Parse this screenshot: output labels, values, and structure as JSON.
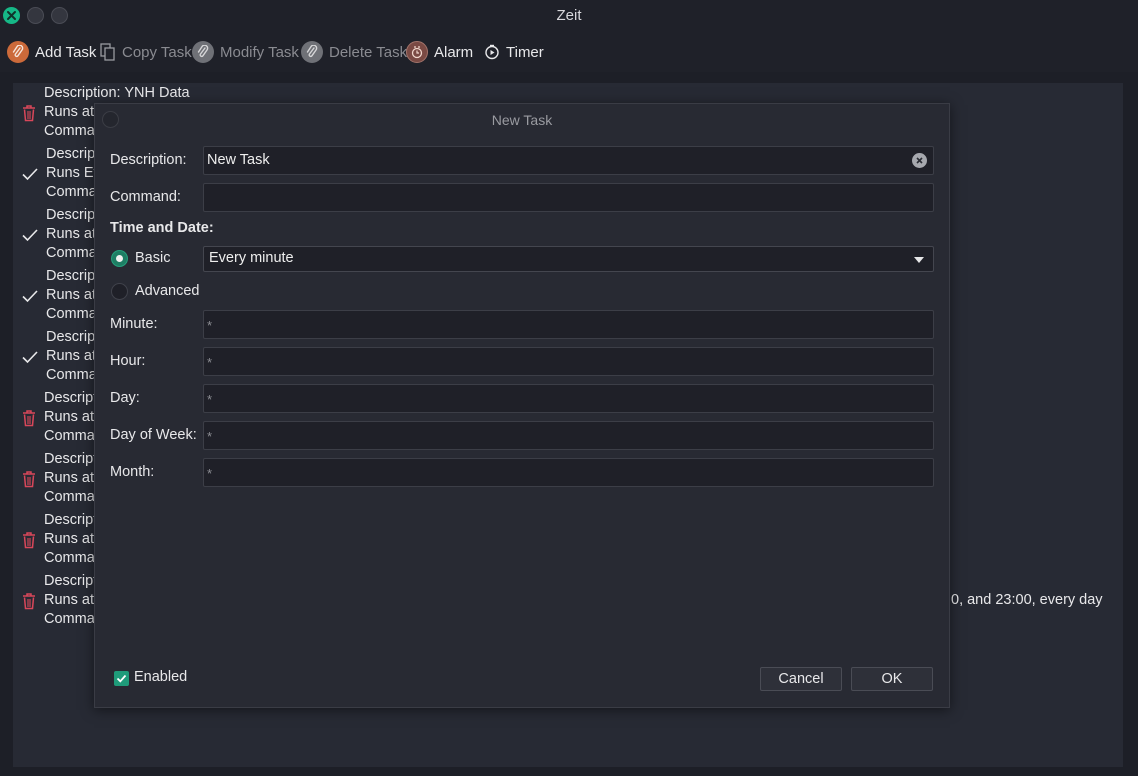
{
  "window": {
    "title": "Zeit"
  },
  "toolbar": {
    "add_task": "Add Task",
    "copy_task": "Copy Task",
    "modify_task": "Modify Task",
    "delete_task": "Delete Task",
    "alarm": "Alarm",
    "timer": "Timer"
  },
  "tasks": [
    {
      "status": "trash-icon",
      "l1": "Description: YNH Data",
      "l2": "Runs at (",
      "l3": "Comman"
    },
    {
      "status": "check-icon",
      "l1": "Descript",
      "l2": "Runs Eve",
      "l3": "Comman"
    },
    {
      "status": "check-icon",
      "l1": "Descript",
      "l2": "Runs at",
      "l3": "Comman"
    },
    {
      "status": "check-icon",
      "l1": "Descript",
      "l2": "Runs at",
      "l3": "Comman"
    },
    {
      "status": "check-icon",
      "l1": "Descript",
      "l2": "Runs at",
      "l3": "Comman"
    },
    {
      "status": "trash-icon",
      "l1": "Descript",
      "l2": "Runs at (",
      "l3": "Comman"
    },
    {
      "status": "trash-icon",
      "l1": "Descript",
      "l2": "Runs at",
      "l3": "Comman"
    },
    {
      "status": "trash-icon",
      "l1": "Descript",
      "l2": "Runs at",
      "l3": "Comman"
    },
    {
      "status": "trash-icon",
      "l1": "Descript",
      "l2": "Runs at (",
      "l3": "Comman"
    }
  ],
  "task_overflow_text": "0, and 23:00, every day",
  "dialog": {
    "title": "New Task",
    "description_label": "Description:",
    "description_value": "New Task",
    "command_label": "Command:",
    "command_value": "",
    "time_date_heading": "Time and Date:",
    "basic_label": "Basic",
    "basic_selected": true,
    "basic_option": "Every minute",
    "advanced_label": "Advanced",
    "minute_label": "Minute:",
    "minute_placeholder": "*",
    "hour_label": "Hour:",
    "hour_placeholder": "*",
    "day_label": "Day:",
    "day_placeholder": "*",
    "dow_label": "Day of Week:",
    "dow_placeholder": "*",
    "month_label": "Month:",
    "month_placeholder": "*",
    "enabled_label": "Enabled",
    "enabled_checked": true,
    "cancel_label": "Cancel",
    "ok_label": "OK"
  },
  "colors": {
    "accent": "#1f9b7a",
    "close_button": "#16b887",
    "trash": "#d9475a",
    "add_icon": "#cc6a3a"
  }
}
